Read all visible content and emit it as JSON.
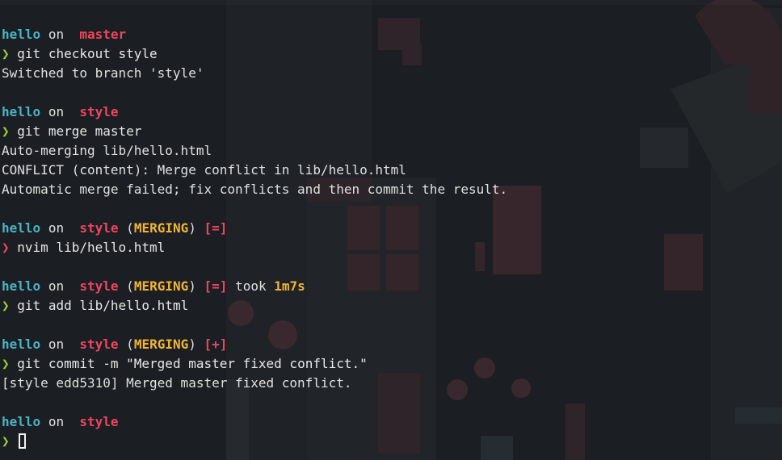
{
  "prompt_symbol": "❯",
  "branch_icon": "",
  "on_word": "on",
  "colors": {
    "directory": "#49b3c4",
    "branch": "#f0455f",
    "merging": "#f2b437",
    "prompt_ok": "#9bd23c",
    "prompt_error": "#f0455f"
  },
  "blocks": [
    {
      "dir": "hello",
      "branch": "master",
      "state": "",
      "status": "",
      "took_label": "",
      "took_value": "",
      "prompt_status": "ok",
      "command": "git checkout style",
      "output": [
        "Switched to branch 'style'"
      ]
    },
    {
      "dir": "hello",
      "branch": "style",
      "state": "",
      "status": "",
      "took_label": "",
      "took_value": "",
      "prompt_status": "ok",
      "command": "git merge master",
      "output": [
        "Auto-merging lib/hello.html",
        "CONFLICT (content): Merge conflict in lib/hello.html",
        "Automatic merge failed; fix conflicts and then commit the result."
      ]
    },
    {
      "dir": "hello",
      "branch": "style",
      "state": "MERGING",
      "status": "[=]",
      "took_label": "",
      "took_value": "",
      "prompt_status": "error",
      "command": "nvim lib/hello.html",
      "output": []
    },
    {
      "dir": "hello",
      "branch": "style",
      "state": "MERGING",
      "status": "[=]",
      "took_label": "took",
      "took_value": "1m7s",
      "prompt_status": "ok",
      "command": "git add lib/hello.html",
      "output": []
    },
    {
      "dir": "hello",
      "branch": "style",
      "state": "MERGING",
      "status": "[+]",
      "took_label": "",
      "took_value": "",
      "prompt_status": "ok",
      "command": "git commit -m \"Merged master fixed conflict.\"",
      "output": [
        "[style edd5310] Merged master fixed conflict."
      ]
    },
    {
      "dir": "hello",
      "branch": "style",
      "state": "",
      "status": "",
      "took_label": "",
      "took_value": "",
      "prompt_status": "ok",
      "command": "",
      "output": [],
      "cursor": true
    }
  ]
}
